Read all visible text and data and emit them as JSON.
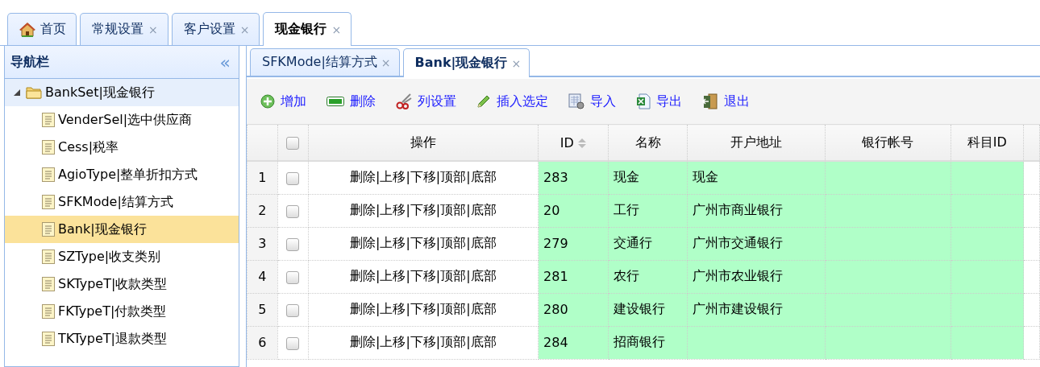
{
  "main_tabs": [
    {
      "label": "首页",
      "kind": "home",
      "closable": false,
      "selected": false
    },
    {
      "label": "常规设置",
      "kind": "page",
      "closable": true,
      "selected": false
    },
    {
      "label": "客户设置",
      "kind": "page",
      "closable": true,
      "selected": false
    },
    {
      "label": "现金银行",
      "kind": "page",
      "closable": true,
      "selected": true
    }
  ],
  "close_mark": "×",
  "navigation": {
    "title": "导航栏",
    "collapse": "«",
    "tree": [
      {
        "label": "BankSet|现金银行",
        "expanded": true,
        "selected": false,
        "children": [
          {
            "label": "VenderSel|选中供应商",
            "selected": false
          },
          {
            "label": "Cess|税率",
            "selected": false
          },
          {
            "label": "AgioType|整单折扣方式",
            "selected": false
          },
          {
            "label": "SFKMode|结算方式",
            "selected": false
          },
          {
            "label": "Bank|现金银行",
            "selected": true
          },
          {
            "label": "SZType|收支类别",
            "selected": false
          },
          {
            "label": "SKTypeT|收款类型",
            "selected": false
          },
          {
            "label": "FKTypeT|付款类型",
            "selected": false
          },
          {
            "label": "TKTypeT|退款类型",
            "selected": false
          }
        ]
      }
    ]
  },
  "sub_tabs": [
    {
      "label": "SFKMode|结算方式",
      "selected": false
    },
    {
      "label": "Bank|现金银行",
      "selected": true
    }
  ],
  "toolbar": [
    {
      "label": "增加",
      "kind": "add"
    },
    {
      "label": "删除",
      "kind": "remove"
    },
    {
      "label": "列设置",
      "kind": "cut"
    },
    {
      "label": "插入选定",
      "kind": "edit"
    },
    {
      "label": "导入",
      "kind": "import"
    },
    {
      "label": "导出",
      "kind": "export"
    },
    {
      "label": "退出",
      "kind": "exit"
    }
  ],
  "grid": {
    "header_checked": false,
    "columns": [
      {
        "label": "操作",
        "sortable": false
      },
      {
        "label": "ID",
        "sortable": true
      },
      {
        "label": "名称",
        "sortable": false
      },
      {
        "label": "开户地址",
        "sortable": false
      },
      {
        "label": "银行帐号",
        "sortable": false
      },
      {
        "label": "科目ID",
        "sortable": false
      }
    ],
    "rows": [
      {
        "number": "1",
        "checked": false,
        "cells": [
          "删除|上移|下移|顶部|底部",
          "283",
          "现金",
          "现金",
          "",
          ""
        ]
      },
      {
        "number": "2",
        "checked": false,
        "cells": [
          "删除|上移|下移|顶部|底部",
          "20",
          "工行",
          "广州市商业银行",
          "",
          ""
        ]
      },
      {
        "number": "3",
        "checked": false,
        "cells": [
          "删除|上移|下移|顶部|底部",
          "279",
          "交通行",
          "广州市交通银行",
          "",
          ""
        ]
      },
      {
        "number": "4",
        "checked": false,
        "cells": [
          "删除|上移|下移|顶部|底部",
          "281",
          "农行",
          "广州市农业银行",
          "",
          ""
        ]
      },
      {
        "number": "5",
        "checked": false,
        "cells": [
          "删除|上移|下移|顶部|底部",
          "280",
          "建设银行",
          "广州市建设银行",
          "",
          ""
        ]
      },
      {
        "number": "6",
        "checked": false,
        "cells": [
          "删除|上移|下移|顶部|底部",
          "284",
          "招商银行",
          "",
          "",
          ""
        ]
      }
    ]
  }
}
